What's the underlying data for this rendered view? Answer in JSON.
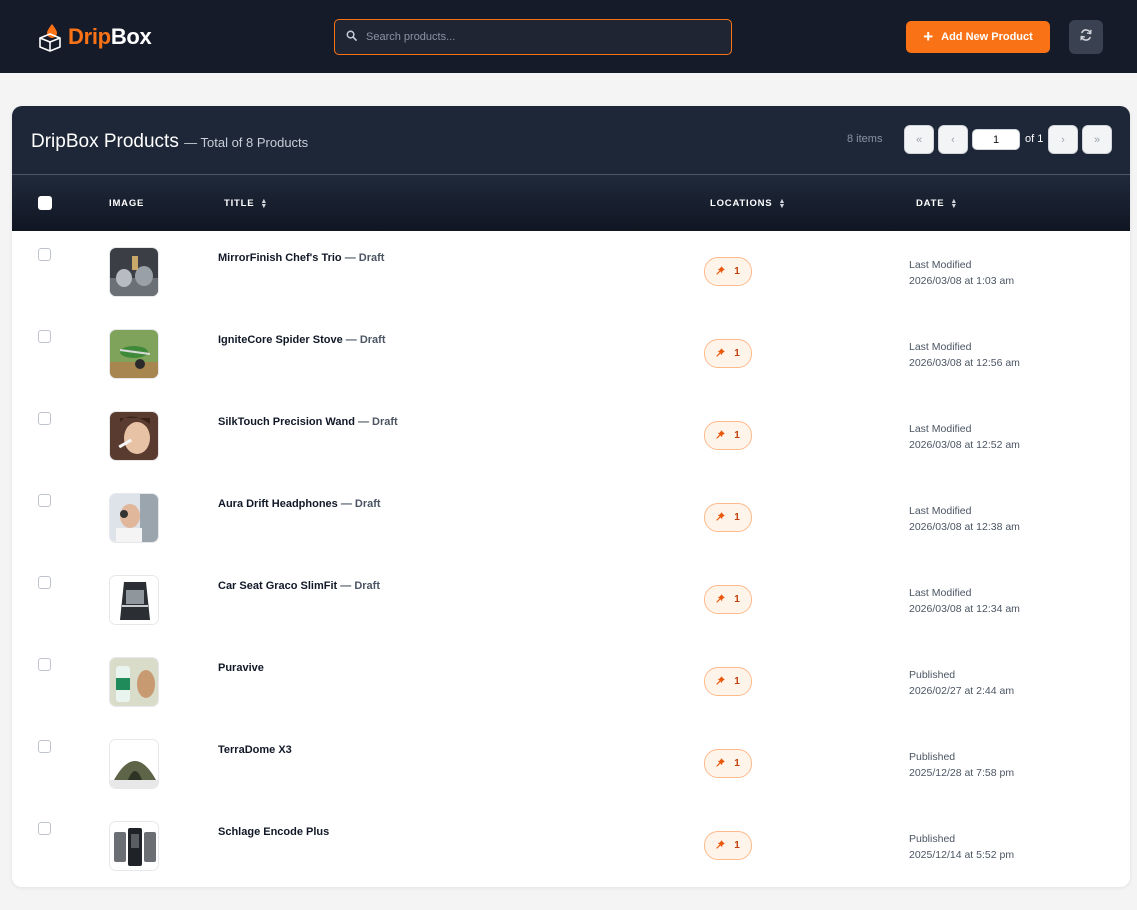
{
  "brand": {
    "part1": "Drip",
    "part2": "Box",
    "accent": "#f97316"
  },
  "search": {
    "placeholder": "Search products..."
  },
  "actions": {
    "add_label": "Add New Product",
    "refresh_icon": "refresh-icon"
  },
  "card": {
    "title": "DripBox Products",
    "subtitle": "— Total of 8 Products",
    "items_count": "8 items",
    "pagination": {
      "first": "«",
      "prev": "‹",
      "page": "1",
      "of": "of 1",
      "next": "›",
      "last": "»"
    }
  },
  "table": {
    "headers": {
      "image": "IMAGE",
      "title": "TITLE",
      "locations": "LOCATIONS",
      "date": "DATE"
    },
    "rows": [
      {
        "title": "MirrorFinish Chef's Trio",
        "status": " — Draft",
        "locations": "1",
        "date_label": "Last Modified",
        "date": "2026/03/08 at 1:03 am"
      },
      {
        "title": "IgniteCore Spider Stove",
        "status": " — Draft",
        "locations": "1",
        "date_label": "Last Modified",
        "date": "2026/03/08 at 12:56 am"
      },
      {
        "title": "SilkTouch Precision Wand",
        "status": " — Draft",
        "locations": "1",
        "date_label": "Last Modified",
        "date": "2026/03/08 at 12:52 am"
      },
      {
        "title": "Aura Drift Headphones",
        "status": " — Draft",
        "locations": "1",
        "date_label": "Last Modified",
        "date": "2026/03/08 at 12:38 am"
      },
      {
        "title": "Car Seat Graco SlimFit",
        "status": " — Draft",
        "locations": "1",
        "date_label": "Last Modified",
        "date": "2026/03/08 at 12:34 am"
      },
      {
        "title": "Puravive",
        "status": "",
        "locations": "1",
        "date_label": "Published",
        "date": "2026/02/27 at 2:44 am"
      },
      {
        "title": "TerraDome X3",
        "status": "",
        "locations": "1",
        "date_label": "Published",
        "date": "2025/12/28 at 7:58 pm"
      },
      {
        "title": "Schlage Encode Plus",
        "status": "",
        "locations": "1",
        "date_label": "Published",
        "date": "2025/12/14 at 5:52 pm"
      }
    ]
  }
}
